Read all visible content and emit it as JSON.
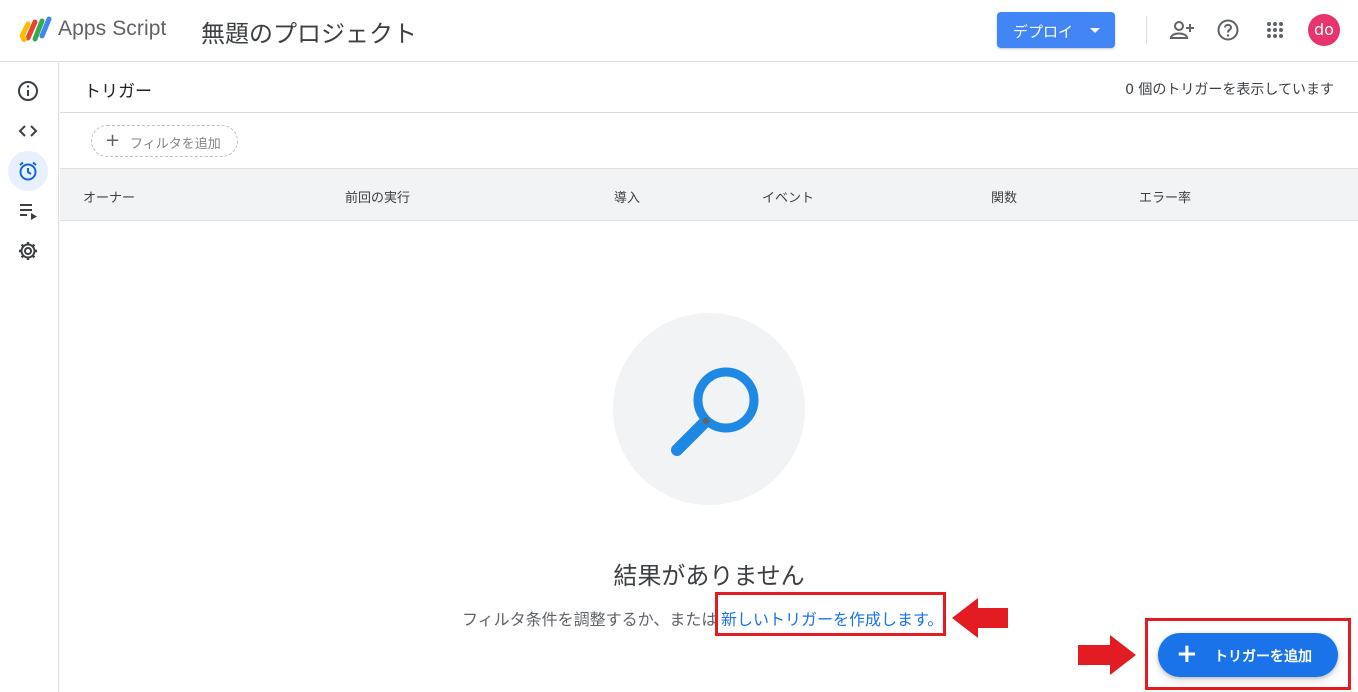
{
  "app": {
    "name": "Apps Script",
    "project_title": "無題のプロジェクト"
  },
  "toolbar": {
    "deploy_label": "デプロイ",
    "avatar_initials": "do",
    "avatar_color": "#e8336d"
  },
  "sidebar": {
    "items": [
      {
        "icon": "info-icon",
        "name": "overview"
      },
      {
        "icon": "code-icon",
        "name": "editor"
      },
      {
        "icon": "alarm-clock-icon",
        "name": "triggers",
        "active": true
      },
      {
        "icon": "executions-icon",
        "name": "executions"
      },
      {
        "icon": "gear-icon",
        "name": "settings"
      }
    ]
  },
  "page": {
    "title": "トリガー",
    "count_text": "0 個のトリガーを表示しています"
  },
  "filter": {
    "plus": "+",
    "label": "フィルタを追加"
  },
  "table": {
    "columns": [
      "オーナー",
      "前回の実行",
      "導入",
      "イベント",
      "関数",
      "エラー率"
    ]
  },
  "empty": {
    "title": "結果がありません",
    "hint": "フィルタ条件を調整するか、または",
    "link": "新しいトリガーを作成します。"
  },
  "fab": {
    "plus": "+",
    "label": "トリガーを追加"
  },
  "colors": {
    "accent": "#1a73e8",
    "deploy": "#4285f4",
    "highlight": "#e31b23",
    "search_icon": "#1e88e5"
  }
}
